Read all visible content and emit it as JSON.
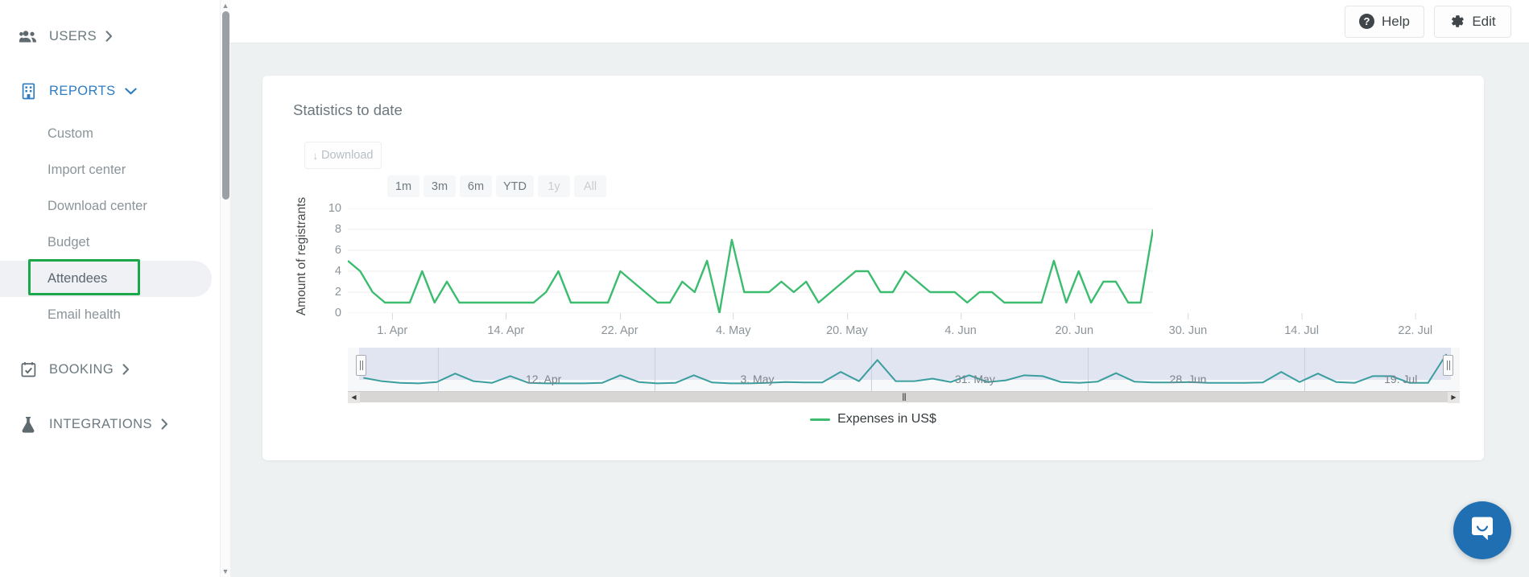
{
  "sidebar": {
    "groups": [
      {
        "label": "USERS",
        "icon": "users-icon",
        "chevron": "chevron-right-icon",
        "active": false
      },
      {
        "label": "REPORTS",
        "icon": "building-icon",
        "chevron": "chevron-down-icon",
        "active": true
      },
      {
        "label": "BOOKING",
        "icon": "calendar-check-icon",
        "chevron": "chevron-right-icon",
        "active": false
      },
      {
        "label": "INTEGRATIONS",
        "icon": "flask-icon",
        "chevron": "chevron-right-icon",
        "active": false
      }
    ],
    "reports_items": [
      {
        "label": "Custom",
        "selected": false
      },
      {
        "label": "Import center",
        "selected": false
      },
      {
        "label": "Download center",
        "selected": false
      },
      {
        "label": "Budget",
        "selected": false
      },
      {
        "label": "Attendees",
        "selected": true
      },
      {
        "label": "Email health",
        "selected": false
      }
    ],
    "highlight_color": "#1aa84a"
  },
  "topbar": {
    "help_label": "Help",
    "help_icon": "question-circle-icon",
    "edit_label": "Edit",
    "edit_icon": "gear-icon"
  },
  "card": {
    "title": "Statistics to date",
    "download_label": "Download",
    "download_icon": "download-arrow-icon"
  },
  "chart_data": {
    "type": "line",
    "title": "Statistics to date",
    "xlabel": "",
    "ylabel": "Amount of registrants",
    "ylim": [
      0,
      10
    ],
    "yticks": [
      0,
      2,
      4,
      6,
      8,
      10
    ],
    "grid": true,
    "legend_position": "bottom",
    "legend": [
      "Expenses in US$"
    ],
    "series_color": "#3cbc6e",
    "xticks": [
      "1. Apr",
      "14. Apr",
      "22. Apr",
      "4. May",
      "20. May",
      "4. Jun",
      "20. Jun",
      "30. Jun",
      "14. Jul",
      "22. Jul"
    ],
    "series": [
      {
        "name": "Expenses in US$",
        "values": [
          5,
          4,
          2,
          1,
          1,
          1,
          4,
          1,
          3,
          1,
          1,
          1,
          1,
          1,
          1,
          1,
          2,
          4,
          1,
          1,
          1,
          1,
          4,
          3,
          2,
          1,
          1,
          3,
          2,
          5,
          0,
          7,
          2,
          2,
          2,
          3,
          2,
          3,
          1,
          2,
          3,
          4,
          4,
          2,
          2,
          4,
          3,
          2,
          2,
          2,
          1,
          2,
          2,
          1,
          1,
          1,
          1,
          5,
          1,
          4,
          1,
          3,
          3,
          1,
          1,
          8
        ]
      }
    ],
    "range_buttons": [
      {
        "label": "1m",
        "enabled": true,
        "selected": false
      },
      {
        "label": "3m",
        "enabled": true,
        "selected": false
      },
      {
        "label": "6m",
        "enabled": true,
        "selected": false
      },
      {
        "label": "YTD",
        "enabled": true,
        "selected": false
      },
      {
        "label": "1y",
        "enabled": false,
        "selected": false
      },
      {
        "label": "All",
        "enabled": false,
        "selected": false
      }
    ],
    "navigator": {
      "xticks": [
        "12. Apr",
        "3. May",
        "31. May",
        "28. Jun",
        "19. Jul"
      ],
      "series_color": "#3a9e9e",
      "mask_color": "#dde1ee",
      "values": [
        2,
        1.2,
        0.8,
        0.7,
        1,
        3,
        1.2,
        0.8,
        2.4,
        0.8,
        0.7,
        0.7,
        0.7,
        0.8,
        2.6,
        1,
        0.7,
        0.8,
        2.6,
        0.9,
        0.7,
        0.7,
        0.8,
        1,
        0.9,
        0.9,
        3.4,
        1.2,
        6.2,
        1.2,
        1.2,
        1.8,
        1,
        2.6,
        1,
        1.4,
        2.6,
        2.4,
        1,
        0.8,
        1.1,
        3.1,
        1.1,
        0.9,
        0.9,
        1,
        0.8,
        0.8,
        0.8,
        0.9,
        3.4,
        1,
        3,
        1,
        0.8,
        2.4,
        2.4,
        0.8,
        0.8,
        7.6
      ]
    }
  },
  "legend": {
    "label": "Expenses in US$",
    "color": "#3cbc6e"
  },
  "intercom": {
    "icon": "chat-bubble-smile-icon",
    "color": "#1f6fb2"
  },
  "scrollbars": {
    "sidebar_up_arrow": "▲",
    "sidebar_down_arrow": "▼",
    "navigator_left_arrow": "◀",
    "navigator_right_arrow": "▶",
    "navigator_grip": "|||"
  }
}
